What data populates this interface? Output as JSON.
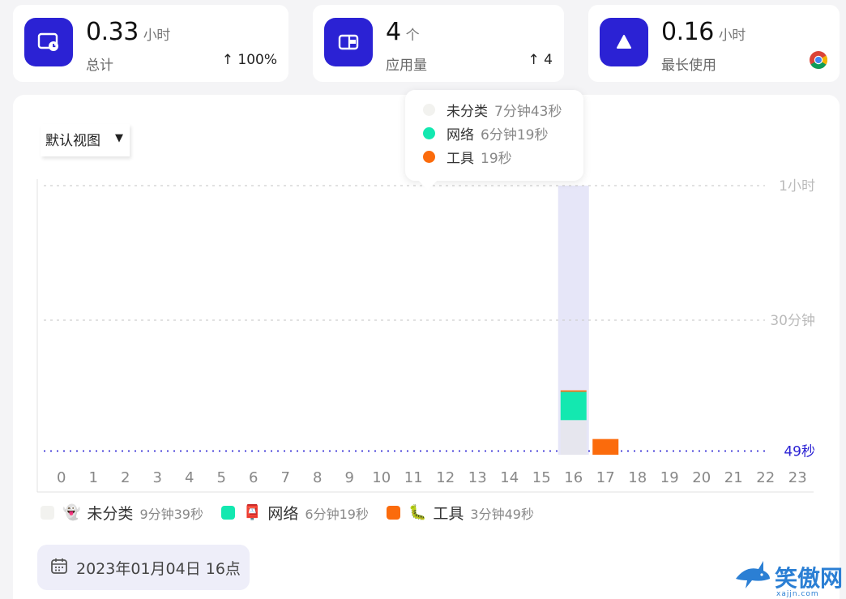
{
  "stats": [
    {
      "icon": "clock-screen-icon",
      "value": "0.33",
      "unit": "小时",
      "label": "总计",
      "trend": "↑ 100%"
    },
    {
      "icon": "app-window-icon",
      "value": "4",
      "unit": "个",
      "label": "应用量",
      "trend": "↑ 4"
    },
    {
      "icon": "triangle-icon",
      "value": "0.16",
      "unit": "小时",
      "label": "最长使用",
      "trend_icon": "chrome-icon"
    }
  ],
  "view_select": {
    "label": "默认视图"
  },
  "tooltip": {
    "rows": [
      {
        "name": "未分类",
        "duration": "7分钟43秒",
        "color": "#f2f2ef"
      },
      {
        "name": "网络",
        "duration": "6分钟19秒",
        "color": "#13e8b0"
      },
      {
        "name": "工具",
        "duration": "19秒",
        "color": "#fb6b0c"
      }
    ]
  },
  "chart_data": {
    "type": "bar",
    "stacked": true,
    "categories": [
      "0",
      "1",
      "2",
      "3",
      "4",
      "5",
      "6",
      "7",
      "8",
      "9",
      "10",
      "11",
      "12",
      "13",
      "14",
      "15",
      "16",
      "17",
      "18",
      "19",
      "20",
      "21",
      "22",
      "23"
    ],
    "series": [
      {
        "name": "未分类",
        "color": "#e6e6ee",
        "values": [
          0,
          0,
          0,
          0,
          0,
          0,
          0,
          0,
          0,
          0,
          0,
          0,
          0,
          0,
          0,
          0,
          463,
          0,
          0,
          0,
          0,
          0,
          0,
          0
        ]
      },
      {
        "name": "网络",
        "color": "#13e8b0",
        "values": [
          0,
          0,
          0,
          0,
          0,
          0,
          0,
          0,
          0,
          0,
          0,
          0,
          0,
          0,
          0,
          0,
          379,
          0,
          0,
          0,
          0,
          0,
          0,
          0
        ]
      },
      {
        "name": "工具",
        "color": "#fb6b0c",
        "values": [
          0,
          0,
          0,
          0,
          0,
          0,
          0,
          0,
          0,
          0,
          0,
          0,
          0,
          0,
          0,
          0,
          19,
          210,
          0,
          0,
          0,
          0,
          0,
          0
        ]
      }
    ],
    "y_unit": "seconds",
    "y_tick_labels": [
      "1小时",
      "30分钟",
      "49秒"
    ],
    "y_ticks": [
      3600,
      1800,
      49
    ],
    "ylim": [
      0,
      3600
    ],
    "highlighted_category": "16",
    "grid": true
  },
  "legend": [
    {
      "name": "未分类",
      "emoji": "👻",
      "duration": "9分钟39秒",
      "color": "#f2f2ef"
    },
    {
      "name": "网络",
      "emoji": "📮",
      "duration": "6分钟19秒",
      "color": "#13e8b0"
    },
    {
      "name": "工具",
      "emoji": "🐛",
      "duration": "3分钟49秒",
      "color": "#fb6b0c"
    }
  ],
  "date_chip": {
    "label": "2023年01月04日 16点"
  },
  "watermark": {
    "text": "笑傲网",
    "sub": "xajjn.com"
  },
  "colors": {
    "accent": "#2b22d4",
    "avg_line": "#2b22d4"
  }
}
